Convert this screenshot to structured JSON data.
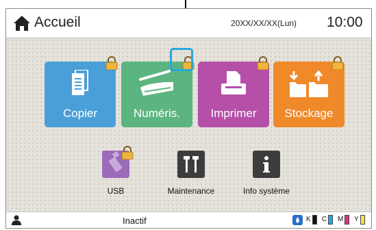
{
  "header": {
    "title": "Accueil",
    "date": "20XX/XX/XX(Lun)",
    "time": "10:00"
  },
  "tiles": [
    {
      "label": "Copier",
      "color": "#4a9fd8",
      "icon": "copy-icon",
      "locked": true
    },
    {
      "label": "Numéris.",
      "color": "#5cb580",
      "icon": "scanner-icon",
      "locked": true
    },
    {
      "label": "Imprimer",
      "color": "#b54fa8",
      "icon": "printer-icon",
      "locked": true
    },
    {
      "label": "Stockage",
      "color": "#f0892a",
      "icon": "folder-storage-icon",
      "locked": true
    }
  ],
  "small_tiles": [
    {
      "label": "USB",
      "color": "#9b6ab8",
      "icon": "usb-icon",
      "locked": true
    },
    {
      "label": "Maintenance",
      "color": "#3d3d3d",
      "icon": "tools-icon",
      "locked": false
    },
    {
      "label": "Info système",
      "color": "#3d3d3d",
      "icon": "info-icon",
      "locked": false
    }
  ],
  "footer": {
    "status": "Inactif",
    "ink": [
      {
        "label": "K",
        "color": "#111111"
      },
      {
        "label": "C",
        "color": "#29a7dd"
      },
      {
        "label": "M",
        "color": "#d6338a"
      },
      {
        "label": "Y",
        "color": "#f3e24a"
      }
    ]
  },
  "colors": {
    "highlight": "#29a7dd",
    "lock": "#f0b53c"
  }
}
